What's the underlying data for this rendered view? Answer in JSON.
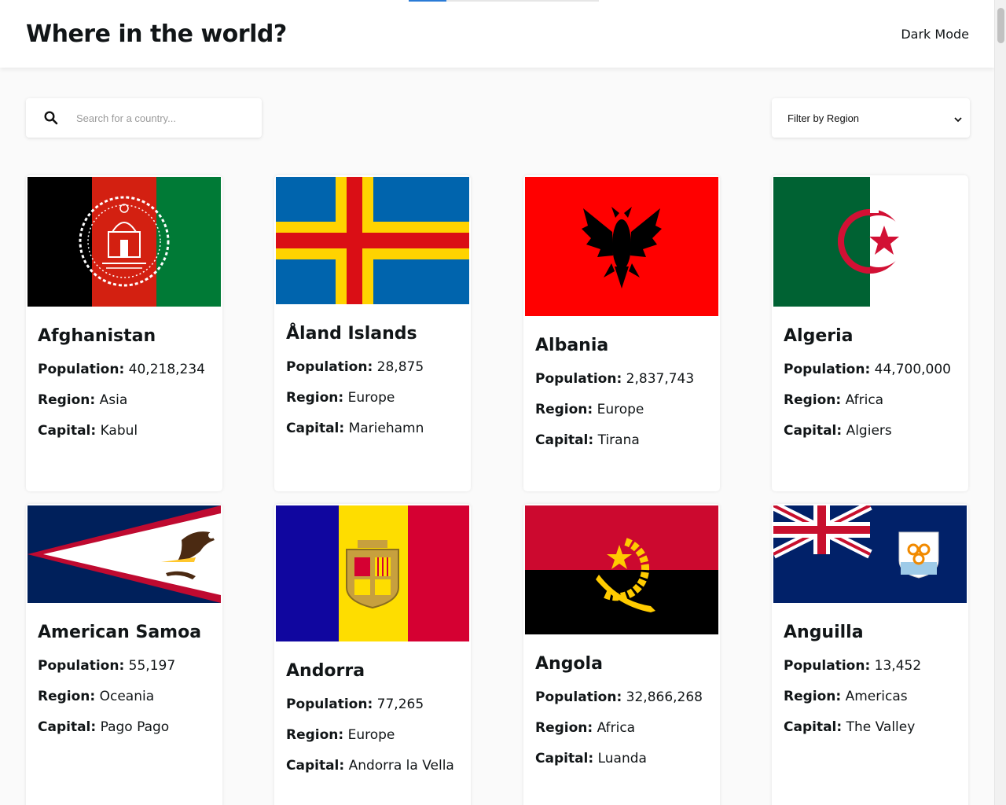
{
  "header": {
    "title": "Where in the world?",
    "theme_toggle_label": "Dark Mode"
  },
  "search": {
    "placeholder": "Search for a country...",
    "value": ""
  },
  "filter": {
    "selected": "Filter by Region"
  },
  "labels": {
    "population": "Population:",
    "region": "Region:",
    "capital": "Capital:"
  },
  "countries": [
    {
      "name": "Afghanistan",
      "population": "40,218,234",
      "region": "Asia",
      "capital": "Kabul"
    },
    {
      "name": "Åland Islands",
      "population": "28,875",
      "region": "Europe",
      "capital": "Mariehamn"
    },
    {
      "name": "Albania",
      "population": "2,837,743",
      "region": "Europe",
      "capital": "Tirana"
    },
    {
      "name": "Algeria",
      "population": "44,700,000",
      "region": "Africa",
      "capital": "Algiers"
    },
    {
      "name": "American Samoa",
      "population": "55,197",
      "region": "Oceania",
      "capital": "Pago Pago"
    },
    {
      "name": "Andorra",
      "population": "77,265",
      "region": "Europe",
      "capital": "Andorra la Vella"
    },
    {
      "name": "Angola",
      "population": "32,866,268",
      "region": "Africa",
      "capital": "Luanda"
    },
    {
      "name": "Anguilla",
      "population": "13,452",
      "region": "Americas",
      "capital": "The Valley"
    }
  ],
  "colors": {
    "background": "#fafafa",
    "card": "#ffffff",
    "text": "#111517"
  }
}
